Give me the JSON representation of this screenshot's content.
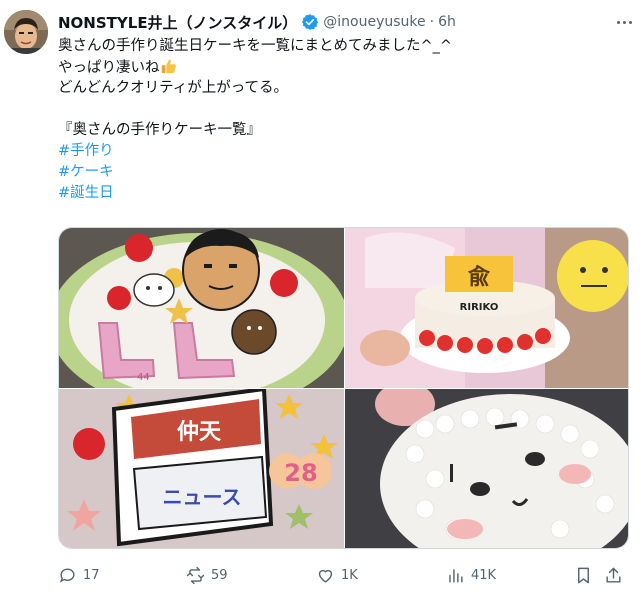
{
  "post": {
    "display_name": "NONSTYLE井上（ノンスタイル）",
    "handle": "@inoueyusuke",
    "separator": "·",
    "time": "6h",
    "text_lines": [
      "奥さんの手作り誕生日ケーキを一覧にまとめてみました^_^",
      "やっぱり凄いね",
      "どんどんクオリティが上がってる。",
      "",
      "『奥さんの手作りケーキ一覧』"
    ],
    "hashtags": [
      "#手作り",
      "#ケーキ",
      "#誕生日"
    ],
    "images": {
      "tile1_number": "44",
      "tile2_banner": "RIRIKO",
      "tile3_top_text": "仲天",
      "tile3_bottom_text": "ニュース",
      "tile3_number": "28"
    }
  },
  "actions": {
    "replies": "17",
    "reposts": "59",
    "likes": "1K",
    "views": "41K"
  },
  "colors": {
    "accent": "#1d9bf0",
    "text": "#0f1419",
    "secondary": "#536471",
    "verified": "#1d9bf0"
  },
  "icons": [
    "verified-badge-icon",
    "thumbs-up-emoji-icon",
    "more-icon",
    "reply-icon",
    "repost-icon",
    "like-icon",
    "views-icon",
    "bookmark-icon",
    "share-icon"
  ]
}
